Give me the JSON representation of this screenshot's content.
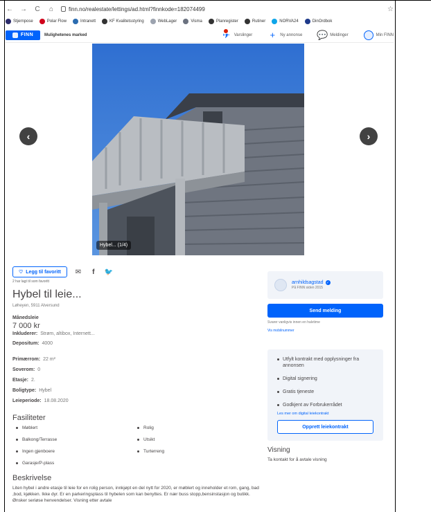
{
  "browser": {
    "url": "finn.no/realestate/lettings/ad.html?finnkode=182074499"
  },
  "bookmarks": [
    {
      "label": "Stjernpose",
      "color": "#2b2b6b"
    },
    {
      "label": "Polar Flow",
      "color": "#d0021b"
    },
    {
      "label": "Intranett",
      "color": "#2b6cb0"
    },
    {
      "label": "KF Kvalitetsstyring",
      "color": "#333333"
    },
    {
      "label": "WebLager",
      "color": "#9ca3af"
    },
    {
      "label": "Visma",
      "color": "#6b7280"
    },
    {
      "label": "Planregister",
      "color": "#333333"
    },
    {
      "label": "Rutiner",
      "color": "#333333"
    },
    {
      "label": "NORVA24",
      "color": "#0ea5e9"
    },
    {
      "label": "DinOrdbok",
      "color": "#1e3a8a"
    }
  ],
  "header": {
    "logo": "FINN",
    "subtitle": "Mulighetenes marked",
    "nav": [
      {
        "label": "Varslinger",
        "icon": "bell-icon"
      },
      {
        "label": "Ny annonse",
        "icon": "plus-icon"
      },
      {
        "label": "Meldinger",
        "icon": "chat-icon"
      },
      {
        "label": "Min FINN",
        "icon": "avatar-icon"
      }
    ]
  },
  "gallery": {
    "caption": "Hybel... (1/4)"
  },
  "listing": {
    "favorite_label": "Legg til favoritt",
    "favorite_count": "2 har lagt til som favoritt",
    "title": "Hybel til leie...",
    "address": "Løheyen, 5911 Alversund",
    "price_label": "Månedsleie",
    "price": "7 000 kr",
    "includes_label": "Inkluderer:",
    "includes_value": "Strøm, altibox, Internett...",
    "deposit_label": "Depositum:",
    "deposit_value": "4000",
    "area_label": "Primærrom:",
    "area_value": "22 m²",
    "bedrooms_label": "Soverom:",
    "bedrooms_value": "0",
    "floor_label": "Etasje:",
    "floor_value": "2.",
    "type_label": "Boligtype:",
    "type_value": "Hybel",
    "period_label": "Leieperiode:",
    "period_value": "18.08.2020",
    "facilities_heading": "Fasiliteter",
    "facilities": [
      "Møblert",
      "Rolig",
      "Balkong/Terrasse",
      "Utsikt",
      "Ingen gjenboere",
      "Turterreng",
      "Garasje/P-plass"
    ],
    "description_heading": "Beskrivelse",
    "description": "Liten hybel i andre etasje til leie for en rolig person, innkjøpt en del nytt for 2020, er møblert og inneholder et rom, gang, bad ,bod, kjøkken. Ikke dyr. Er en parkeringsplass til hybelen som kan benyttes. Er nær buss stopp,bensinstasjon og butikk. Ønsker seriøse henvendelser. Visning etter avtale"
  },
  "seller": {
    "name": "arnhildsagstad",
    "since": "På FINN siden 2015",
    "send_label": "Send melding",
    "reply_note": "Svarer vanligvis innen en halvtime",
    "phone_link": "Vis mobilnummer"
  },
  "contract": {
    "items": [
      "Utfylt kontrakt med opplysninger fra annonsen",
      "Digital signering",
      "Gratis tjeneste",
      "Godkjent av Forbrukerrådet"
    ],
    "link": "Les mer om digital leiekontrakt",
    "button": "Opprett leiekontrakt"
  },
  "viewing": {
    "heading": "Visning",
    "text": "Ta kontakt for å avtale visning"
  }
}
